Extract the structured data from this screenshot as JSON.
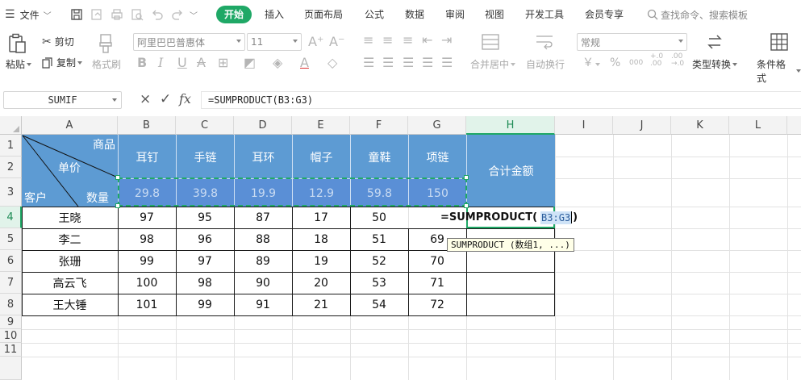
{
  "menubar": {
    "file_label": "文件",
    "tabs": [
      {
        "label": "开始",
        "active": true
      },
      {
        "label": "插入"
      },
      {
        "label": "页面布局"
      },
      {
        "label": "公式"
      },
      {
        "label": "数据"
      },
      {
        "label": "审阅"
      },
      {
        "label": "视图"
      },
      {
        "label": "开发工具"
      },
      {
        "label": "会员专享"
      }
    ],
    "search_placeholder": "查找命令、搜索模板"
  },
  "ribbon": {
    "paste": "粘贴",
    "cut": "剪切",
    "copy": "复制",
    "format_painter": "格式刷",
    "font_name": "阿里巴巴普惠体",
    "font_size": "11",
    "merge_center": "合并居中",
    "wrap_text": "自动换行",
    "number_format": "常规",
    "currency_symbol": "￥",
    "percent_symbol": "%",
    "thousands": "000",
    "convert_type": "类型转换",
    "conditional_format": "条件格式"
  },
  "formula_bar": {
    "name_box": "SUMIF",
    "cancel_icon": "×",
    "confirm_icon": "✓",
    "fx_label": "fx",
    "formula": "=SUMPRODUCT(B3:G3)"
  },
  "grid": {
    "columns": [
      "A",
      "B",
      "C",
      "D",
      "E",
      "F",
      "G",
      "H",
      "I",
      "J",
      "K",
      "L"
    ],
    "rows": [
      "1",
      "2",
      "3",
      "4",
      "5",
      "6",
      "7",
      "8",
      "9",
      "10",
      "11"
    ],
    "active_column": "H",
    "active_row": "4"
  },
  "sheet": {
    "corner_labels": {
      "item": "商品",
      "price": "单价",
      "customer": "客户",
      "qty": "数量"
    },
    "products": [
      "耳钉",
      "手链",
      "耳环",
      "帽子",
      "童鞋",
      "项链"
    ],
    "prices": [
      "29.8",
      "39.8",
      "19.9",
      "12.9",
      "59.8",
      "150"
    ],
    "total_header": "合计金额",
    "customers": [
      {
        "name": "王晓",
        "qty": [
          "97",
          "95",
          "87",
          "17",
          "50",
          ""
        ]
      },
      {
        "name": "李二",
        "qty": [
          "98",
          "96",
          "88",
          "18",
          "51",
          "69"
        ]
      },
      {
        "name": "张珊",
        "qty": [
          "99",
          "97",
          "89",
          "19",
          "52",
          "70"
        ]
      },
      {
        "name": "高云飞",
        "qty": [
          "100",
          "98",
          "90",
          "20",
          "53",
          "71"
        ]
      },
      {
        "name": "王大锤",
        "qty": [
          "101",
          "99",
          "91",
          "21",
          "54",
          "72"
        ]
      }
    ],
    "editing_formula_prefix": "=SUMPRODUCT(",
    "editing_formula_ref": "B3:G3",
    "editing_formula_suffix": ")",
    "tooltip": "SUMPRODUCT (数组1, ...)"
  },
  "colors": {
    "accent": "#1fa866",
    "header_blue": "#5d9bd3",
    "price_blue": "#5a8fd6"
  }
}
